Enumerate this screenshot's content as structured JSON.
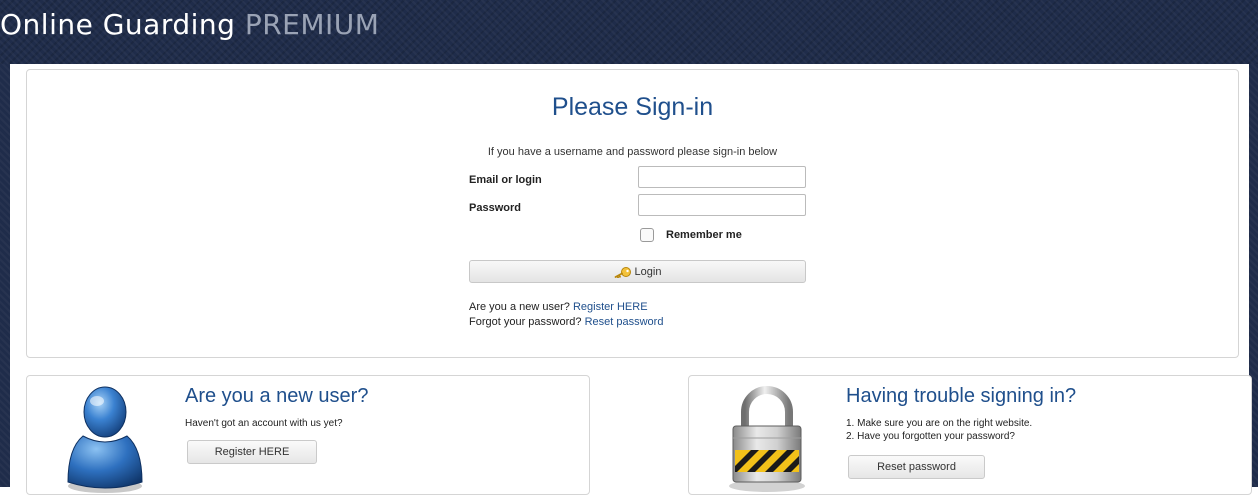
{
  "brand": {
    "main": "Online Guarding",
    "premium": " PREMIUM"
  },
  "signin": {
    "title": "Please Sign-in",
    "intro": "If you have a username and password please sign-in below",
    "email_label": "Email or login",
    "email_value": "",
    "password_label": "Password",
    "password_value": "",
    "remember_label": "Remember me",
    "remember_checked": false,
    "login_label": "Login",
    "login_icon": "key-icon",
    "new_user_text": "Are you a new user?",
    "new_user_link": "Register HERE",
    "forgot_text": "Forgot your password?",
    "forgot_link": "Reset password"
  },
  "new_user_card": {
    "title": "Are you a new user?",
    "text": "Haven't got an account with us yet?",
    "button": "Register HERE",
    "icon": "user-silhouette-icon"
  },
  "trouble_card": {
    "title": "Having trouble signing in?",
    "line1": "1. Make sure you are on the right website.",
    "line2": "2. Have you forgotten your password?",
    "button": "Reset password",
    "icon": "padlock-icon"
  },
  "colors": {
    "header_bg": "#1f2c4a",
    "title_blue": "#1f4f8c",
    "link_blue": "#1f4f8c"
  }
}
